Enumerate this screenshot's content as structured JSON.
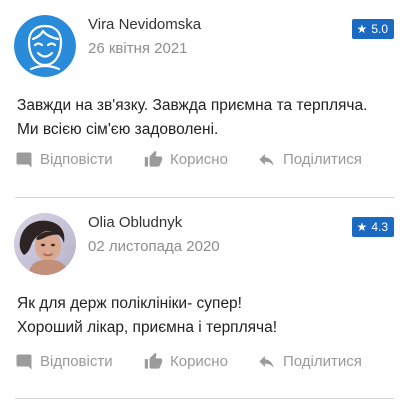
{
  "reviews": [
    {
      "author": "Vira Nevidomska",
      "date": "26 квітня 2021",
      "rating": "5.0",
      "avatar_icon": "smiley-face-icon",
      "lines": [
        "Завжди на зв'язку. Завжда приємна та терпляча.",
        "Ми всією сім'єю задоволені."
      ]
    },
    {
      "author": "Olia Obludnyk",
      "date": "02 листопада 2020",
      "rating": "4.3",
      "avatar_icon": "user-photo",
      "lines": [
        "Як для держ поліклініки- супер!",
        "Хороший лікар, приємна і терпляча!"
      ]
    }
  ],
  "actions": {
    "reply": "Відповісти",
    "helpful": "Корисно",
    "share": "Поділитися"
  },
  "colors": {
    "accent": "#1b6ac1",
    "avatar_blue": "#2a8bdb",
    "muted": "#999999"
  }
}
